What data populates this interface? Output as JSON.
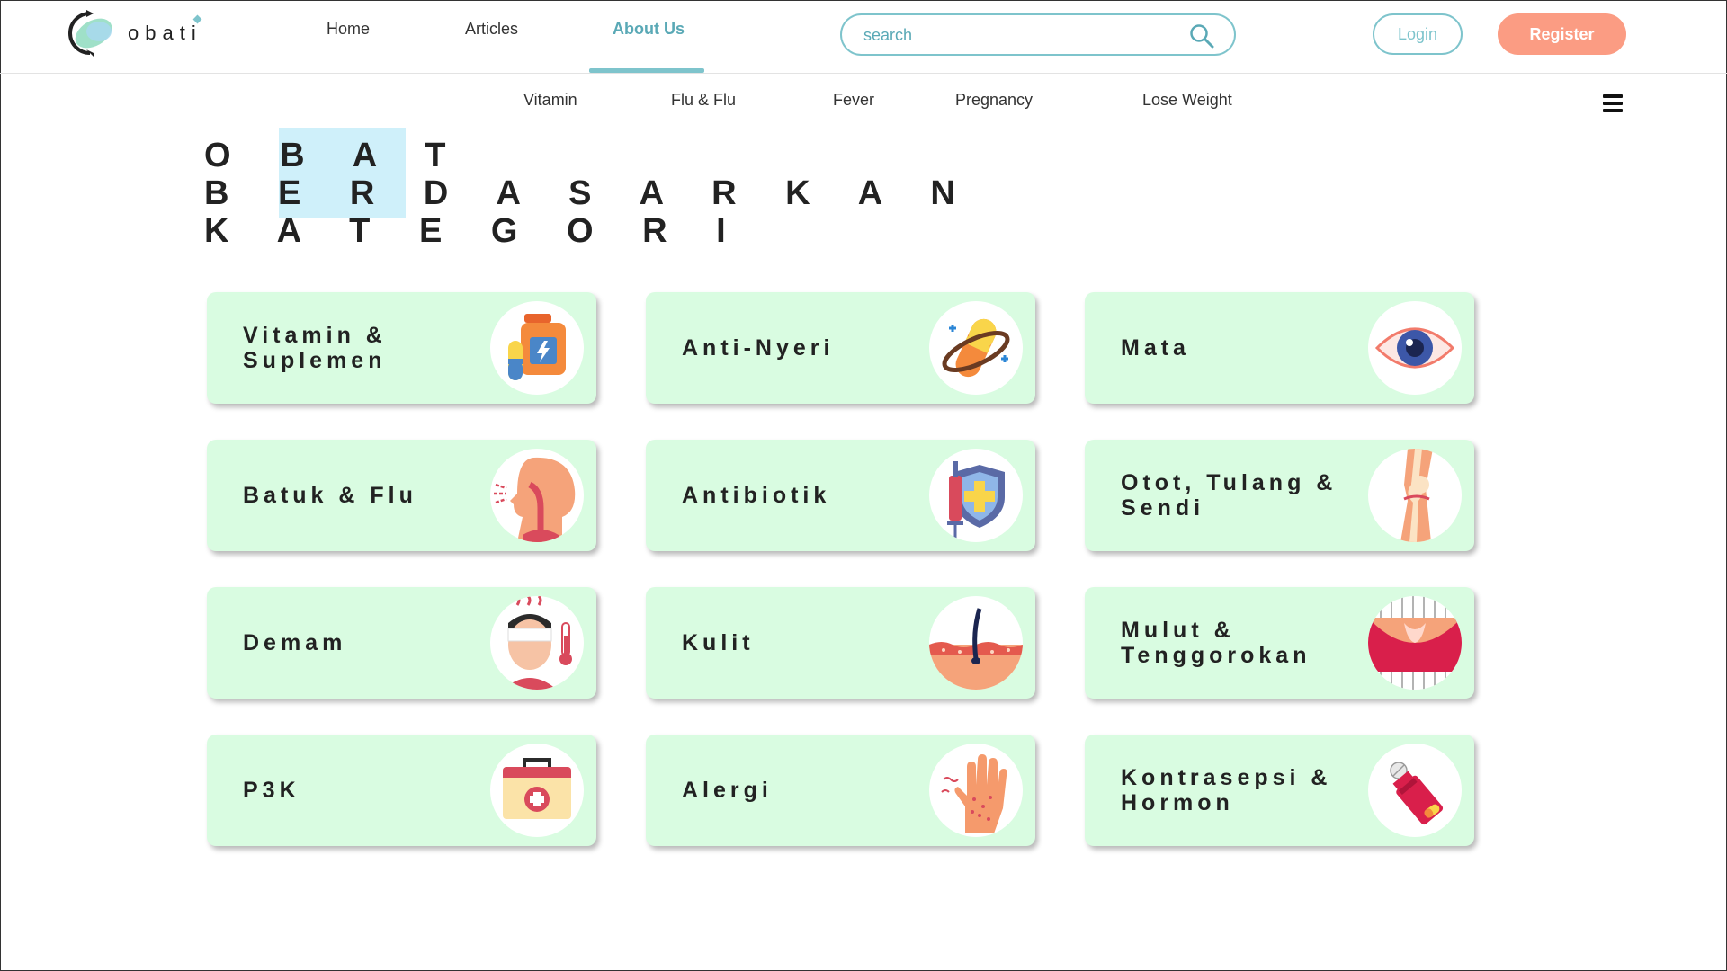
{
  "header": {
    "logo_text": "obati",
    "nav": [
      "Home",
      "Articles",
      "About Us"
    ],
    "active_nav": "About Us",
    "search_placeholder": "search",
    "login_label": "Login",
    "register_label": "Register"
  },
  "subnav": [
    "Vitamin",
    "Flu & Flu",
    "Fever",
    "Pregnancy",
    "Lose Weight"
  ],
  "page_title": {
    "lines": [
      "O B A T",
      "B E R D A S A R K A N",
      "K A T E G O R I"
    ]
  },
  "categories": [
    {
      "label": "Vitamin & Suplemen",
      "icon": "vitamin-bottle-icon"
    },
    {
      "label": "Anti-Nyeri",
      "icon": "pill-capsule-icon"
    },
    {
      "label": "Mata",
      "icon": "eye-icon"
    },
    {
      "label": "Batuk & Flu",
      "icon": "cough-throat-icon"
    },
    {
      "label": "Antibiotik",
      "icon": "syringe-shield-icon"
    },
    {
      "label": "Otot, Tulang & Sendi",
      "icon": "knee-joint-icon"
    },
    {
      "label": "Demam",
      "icon": "fever-thermometer-icon"
    },
    {
      "label": "Kulit",
      "icon": "skin-hair-icon"
    },
    {
      "label": "Mulut & Tenggorokan",
      "icon": "mouth-throat-icon"
    },
    {
      "label": "P3K",
      "icon": "first-aid-kit-icon"
    },
    {
      "label": "Alergi",
      "icon": "allergy-hand-icon"
    },
    {
      "label": "Kontrasepsi & Hormon",
      "icon": "contraceptive-pills-icon"
    }
  ],
  "colors": {
    "accent": "#7ec4cc",
    "register": "#fb9c83",
    "card_bg": "#d9fce1",
    "title_highlight": "#cff0fa"
  }
}
